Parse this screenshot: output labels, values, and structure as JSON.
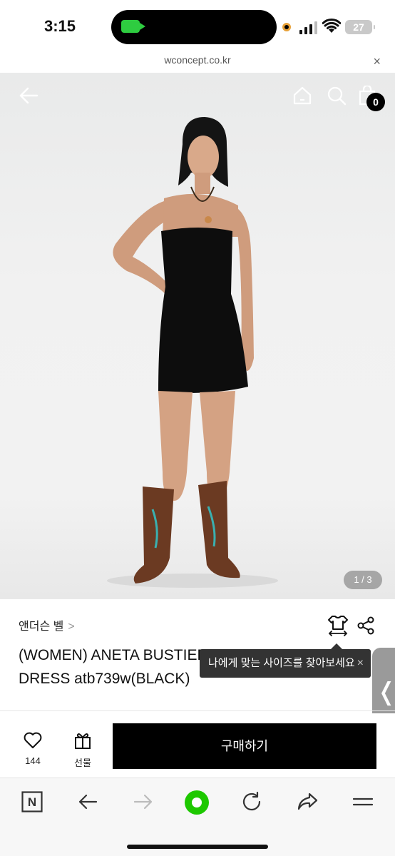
{
  "status_bar": {
    "time": "3:15",
    "battery": "27"
  },
  "browser": {
    "url": "wconcept.co.kr",
    "close_label": "×"
  },
  "hero": {
    "cart_count": "0",
    "image_counter": "1 / 3"
  },
  "product": {
    "brand": "앤더슨 벨",
    "brand_chevron": ">",
    "title": "(WOMEN) ANETA BUSTIER COCKTAIL KNIT DRESS atb739w(BLACK)",
    "size_tooltip": "나에게 맞는 사이즈를 찾아보세요",
    "tooltip_close": "×"
  },
  "side_tab": {
    "label": "❬"
  },
  "purchase": {
    "like_count": "144",
    "gift_label": "선물",
    "buy_label": "구매하기"
  },
  "browser_toolbar": {
    "n_label": "N"
  },
  "colors": {
    "buy_button": "#000000",
    "tooltip_bg": "#333333",
    "naver_green": "#1ec800"
  }
}
